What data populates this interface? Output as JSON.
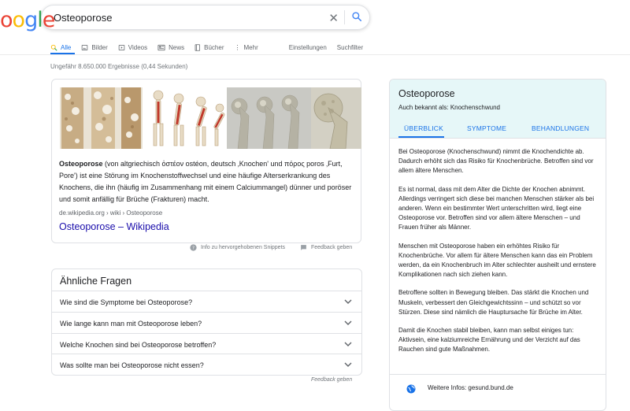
{
  "search": {
    "query": "Osteoporose"
  },
  "tabs": [
    {
      "label": "Alle",
      "icon": "search-icon"
    },
    {
      "label": "Bilder",
      "icon": "image-icon"
    },
    {
      "label": "Videos",
      "icon": "video-icon"
    },
    {
      "label": "News",
      "icon": "news-icon"
    },
    {
      "label": "Bücher",
      "icon": "book-icon"
    },
    {
      "label": "Mehr",
      "icon": "more-vert-icon"
    },
    {
      "label": "Einstellungen"
    },
    {
      "label": "Suchfilter"
    }
  ],
  "result_stats": "Ungefähr 8.650.000 Ergebnisse (0,44 Sekunden)",
  "snippet": {
    "text_bold": "Osteoporose",
    "text_rest": " (von altgriechisch ὀστέον ostéon, deutsch ‚Knochen' und πόρος poros ‚Furt, Pore') ist eine Störung im Knochenstoffwechsel und eine häufige Alterserkrankung des Knochens, die ihn (häufig im Zusammenhang mit einem Calciummangel) dünner und poröser und somit anfällig für Brüche (Frakturen) macht.",
    "cite": "de.wikipedia.org › wiki › Osteoporose",
    "link": "Osteoporose – Wikipedia"
  },
  "snippet_footer": {
    "info": "Info zu hervorgehobenen Snippets",
    "feedback": "Feedback geben"
  },
  "paa": {
    "title": "Ähnliche Fragen",
    "questions": [
      "Wie sind die Symptome bei Osteoporose?",
      "Wie lange kann man mit Osteoporose leben?",
      "Welche Knochen sind bei Osteoporose betroffen?",
      "Was sollte man bei Osteoporose nicht essen?"
    ],
    "feedback": "Feedback geben"
  },
  "knowledge_panel": {
    "title": "Osteoporose",
    "aka": "Auch bekannt als: Knochenschwund",
    "tabs": [
      "ÜBERBLICK",
      "SYMPTOME",
      "BEHANDLUNGEN"
    ],
    "paragraphs": [
      "Bei Osteoporose (Knochenschwund) nimmt die Knochendichte ab. Dadurch erhöht sich das Risiko für Knochenbrüche. Betroffen sind vor allem ältere Menschen.",
      "Es ist normal, dass mit dem Alter die Dichte der Knochen abnimmt. Allerdings verringert sich diese bei manchen Menschen stärker als bei anderen. Wenn ein bestimmter Wert unterschritten wird, liegt eine Osteoporose vor. Betroffen sind vor allem ältere Menschen – und Frauen früher als Männer.",
      "Menschen mit Osteoporose haben ein erhöhtes Risiko für Knochenbrüche. Vor allem für ältere Menschen kann das ein Problem werden, da ein Knochenbruch im Alter schlechter ausheilt und ernstere Komplikationen nach sich ziehen kann.",
      "Betroffene sollten in Bewegung bleiben. Das stärkt die Knochen und Muskeln, verbessert den Gleichgewichtssinn – und schützt so vor Stürzen. Diese sind nämlich die Hauptursache für Brüche im Alter.",
      "Damit die Knochen stabil bleiben, kann man selbst einiges tun: Aktivsein, eine kalziumreiche Ernährung und der Verzicht auf das Rauchen sind gute Maßnahmen."
    ],
    "more_info": "Weitere Infos: gesund.bund.de"
  },
  "colors": {
    "accent": "#1a73e8",
    "link": "#1a0dab",
    "panel_header": "#e6f7f8"
  }
}
